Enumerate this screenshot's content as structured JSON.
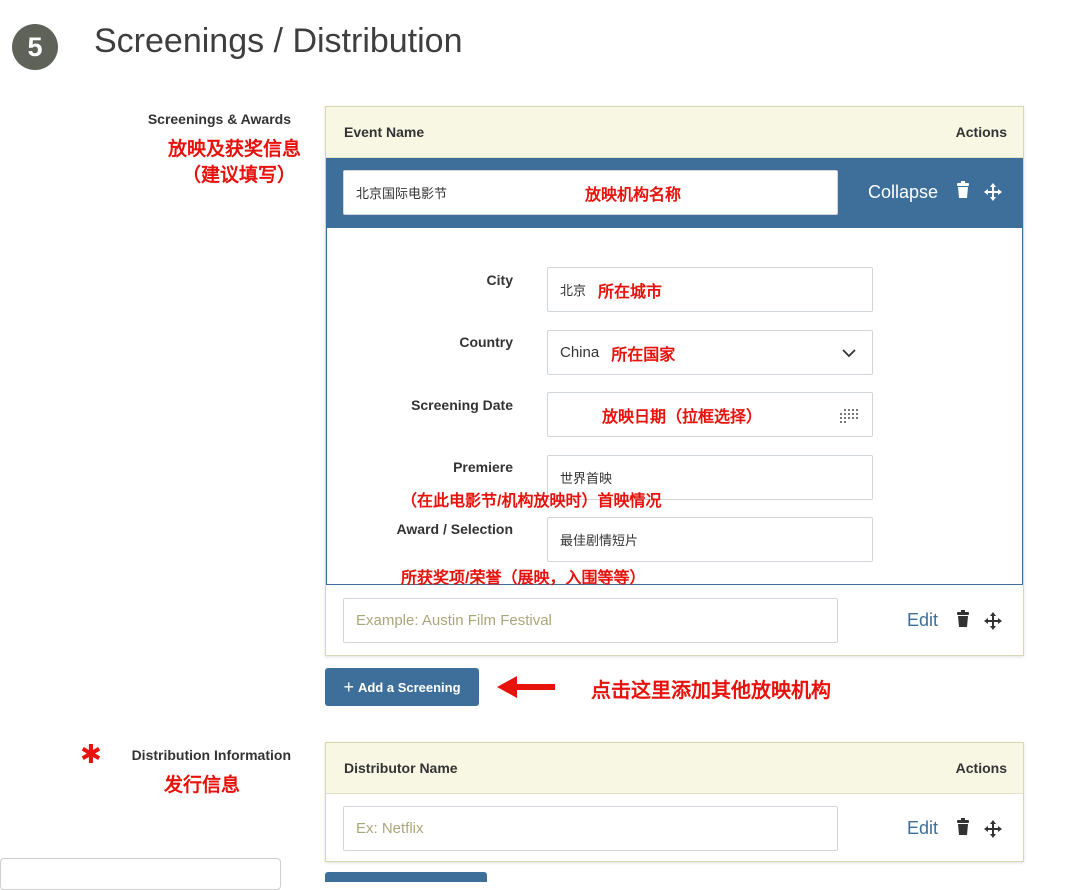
{
  "section": {
    "number": "5",
    "title": "Screenings / Distribution"
  },
  "screenings": {
    "label": "Screenings & Awards",
    "label_cn": "放映及获奖信息",
    "label_cn_note": "（建议填写）",
    "table": {
      "col_event": "Event Name",
      "col_actions": "Actions"
    },
    "expanded_row": {
      "event_name_value": "北京国际电影节",
      "event_name_note": "放映机构名称",
      "collapse_label": "Collapse",
      "fields": {
        "city_label": "City",
        "city_value": "北京",
        "city_note": "所在城市",
        "country_label": "Country",
        "country_value": "China",
        "country_note": "所在国家",
        "date_label": "Screening Date",
        "date_note": "放映日期（拉框选择）",
        "premiere_label": "Premiere",
        "premiere_value": "世界首映",
        "premiere_note": "（在此电影节/机构放映时）首映情况",
        "award_label": "Award / Selection",
        "award_value": "最佳剧情短片",
        "award_note": "所获奖项/荣誉（展映，入围等等）"
      }
    },
    "new_row": {
      "placeholder": "Example: Austin Film Festival",
      "edit_label": "Edit"
    },
    "add_button": "Add a Screening",
    "add_button_plus": "+",
    "add_note": "点击这里添加其他放映机构"
  },
  "distribution": {
    "required_mark": "✱",
    "label": "Distribution Information",
    "label_cn": "发行信息",
    "table": {
      "col_distributor": "Distributor Name",
      "col_actions": "Actions"
    },
    "row": {
      "placeholder": "Ex: Netflix",
      "edit_label": "Edit"
    }
  },
  "colors": {
    "accent_blue": "#3d6f9a",
    "annotation_red": "#e8120c",
    "header_bg": "#f7f7e4"
  }
}
